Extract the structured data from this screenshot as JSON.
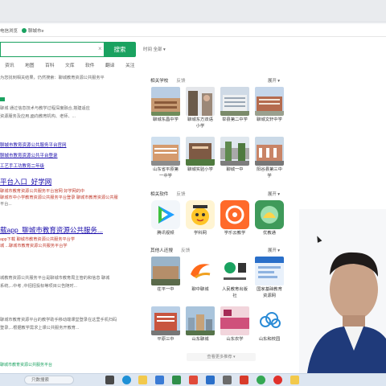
{
  "bookmarks": {
    "item1": "电信浏览",
    "item2": "聊城市e"
  },
  "search": {
    "button_label": "搜索",
    "clear_glyph": "×",
    "filter_label": "时间 全部 ▾"
  },
  "tabs": [
    "资讯",
    "地图",
    "百科",
    "文库",
    "软件",
    "翻译",
    "关注"
  ],
  "results": {
    "notice": "为您找到相关结果，仍然搜索：聊城教育资源公共服务平",
    "r1_snippet1": "聊城 通过信息技术与教学过程深度融合,搭建适应",
    "r1_snippet2": "资源服务及应用,面向教育机构、老师、...",
    "r2_link1": "聊城市教育资源公共服务平台官网",
    "r2_link2": "聊城市教育资源公共平台登录",
    "r2_link3": "工艺手工功教育二年级",
    "r3_title": "平台入口_好学网",
    "r3_red1": "聊城市教育资源公共服务平台官网 好学网的中",
    "r3_red2": "聊城市中小学教育资源公共服务平台登录 聊城市教育资源公共服",
    "r3_small": "平台...",
    "r4_title": "载app_聊城市教育资源公共服务...",
    "r4_red1": "app下载 聊城市教育资源公共服务平台学",
    "r4_red2": "城 ...聊城市教育资源公共服务平台学",
    "r5_small1": "城教育资源公共服务平台是聊城市教育局主管的和信息 聊城",
    "r5_small2": "系统,...中考 ,中招招投标等项目公告随时...",
    "r6_small1": "聊城市教育资源平台的教学助手移动端课堂登录在这里手机扫码",
    "r6_small2": "登录,...根据教学需求上课公共服务开教育...",
    "bottom_link": "聊城市教育资源公共服务平台"
  },
  "sidebar": {
    "sections": [
      {
        "title": "相关学校",
        "feedback": "反馈",
        "more": "展开 ▾",
        "cards": [
          {
            "caption": "聊城东昌中学",
            "icon": "school-building-image"
          },
          {
            "caption": "聊城东方双语小学",
            "icon": "school-building-image"
          },
          {
            "caption": "举县第二中学",
            "icon": "school-building-image"
          },
          {
            "caption": "聊城文轩中学",
            "icon": "school-building-image"
          },
          {
            "caption": "山东省平原第一中学",
            "icon": "school-building-image"
          },
          {
            "caption": "聊城实验小学",
            "icon": "school-building-image"
          },
          {
            "caption": "聊城一中",
            "icon": "school-building-image"
          },
          {
            "caption": "阳谷县第三中学",
            "icon": "school-building-image"
          }
        ]
      },
      {
        "title": "相关软件",
        "feedback": "反馈",
        "more": "展开 ▾",
        "cards": [
          {
            "caption": "腾讯视频",
            "icon": "tencent-video-icon"
          },
          {
            "caption": "学科网",
            "icon": "xueke-app-icon"
          },
          {
            "caption": "学乐云教学",
            "icon": "xuele-app-icon"
          },
          {
            "caption": "优教通",
            "icon": "youjiaotong-app-icon"
          }
        ]
      },
      {
        "title": "其他人还搜",
        "feedback": "反馈",
        "more": "展开 ▾",
        "cards": [
          {
            "caption": "茌平一中",
            "icon": "campus-image"
          },
          {
            "caption": "聊中聊城",
            "icon": "orange-swirl-logo"
          },
          {
            "caption": "人民教育出版社",
            "icon": "publisher-logo"
          },
          {
            "caption": "国家基础教育资源网",
            "icon": "education-site-image"
          },
          {
            "caption": "平原三中",
            "icon": "school-building-image"
          },
          {
            "caption": "山东聊城",
            "icon": "city-image"
          },
          {
            "caption": "山东农学",
            "icon": "china-text-image"
          },
          {
            "caption": "山东和校园",
            "icon": "cloud-logo"
          }
        ]
      }
    ],
    "more_bar": "查看更多推荐 ▾"
  },
  "taskbar": {
    "search_label": "只数搜索"
  },
  "colors": {
    "accent": "#1aa260",
    "link": "#1a0dab",
    "snippet_red": "#c0392b"
  }
}
